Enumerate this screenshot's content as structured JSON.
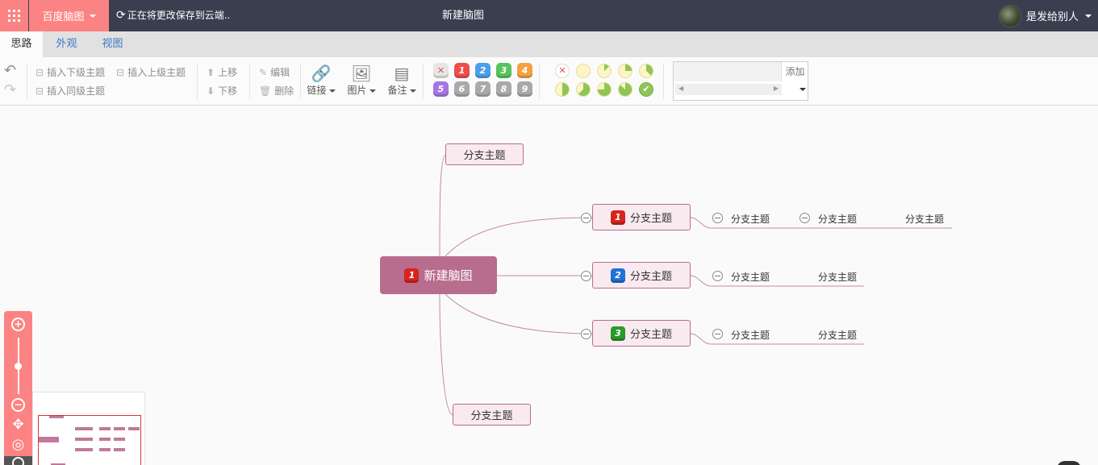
{
  "app": {
    "brand_label": "百度脑图",
    "save_status": "正在将更改保存到云端..",
    "doc_title": "新建脑图",
    "user_name": "是发给别人"
  },
  "tabs": [
    {
      "label": "思路",
      "active": true
    },
    {
      "label": "外观",
      "active": false
    },
    {
      "label": "视图",
      "active": false
    }
  ],
  "toolbar": {
    "insert_child": "插入下级主题",
    "insert_parent": "插入上级主题",
    "insert_sibling": "插入同级主题",
    "move_up": "上移",
    "move_down": "下移",
    "edit": "编辑",
    "delete": "删除",
    "link": "链接",
    "image": "图片",
    "note": "备注",
    "priorities": [
      {
        "label": "✕",
        "color": "#e6e6e6"
      },
      {
        "label": "1",
        "color": "#ef4d4d"
      },
      {
        "label": "2",
        "color": "#4d9fe8"
      },
      {
        "label": "3",
        "color": "#58c35a"
      },
      {
        "label": "4",
        "color": "#f4a142"
      },
      {
        "label": "5",
        "color": "#a576e0"
      },
      {
        "label": "6",
        "color": "#a9a9a9"
      },
      {
        "label": "7",
        "color": "#a9a9a9"
      },
      {
        "label": "8",
        "color": "#a9a9a9"
      },
      {
        "label": "9",
        "color": "#a9a9a9"
      }
    ],
    "progress_levels": [
      "clear",
      "0",
      "1/8",
      "2/8",
      "3/8",
      "4/8",
      "5/8",
      "6/8",
      "7/8",
      "done"
    ],
    "resource_add": "添加",
    "resource_value": ""
  },
  "mindmap": {
    "root": {
      "label": "新建脑图",
      "priority": "1"
    },
    "top_branch": "分支主题",
    "bottom_branch": "分支主题",
    "main_branches": [
      {
        "label": "分支主题",
        "priority": "1",
        "priority_color": "#d8241f",
        "children": [
          "分支主题",
          "分支主题",
          "分支主题"
        ]
      },
      {
        "label": "分支主题",
        "priority": "2",
        "priority_color": "#1f73d8",
        "children": [
          "分支主题",
          "分支主题"
        ]
      },
      {
        "label": "分支主题",
        "priority": "3",
        "priority_color": "#2a9a2a",
        "children": [
          "分支主题",
          "分支主题"
        ]
      }
    ]
  },
  "colors": {
    "topbar": "#393f4f",
    "accent": "#fc8383",
    "node_main": "#b86d8d",
    "node_fill": "#f9eaf0"
  }
}
